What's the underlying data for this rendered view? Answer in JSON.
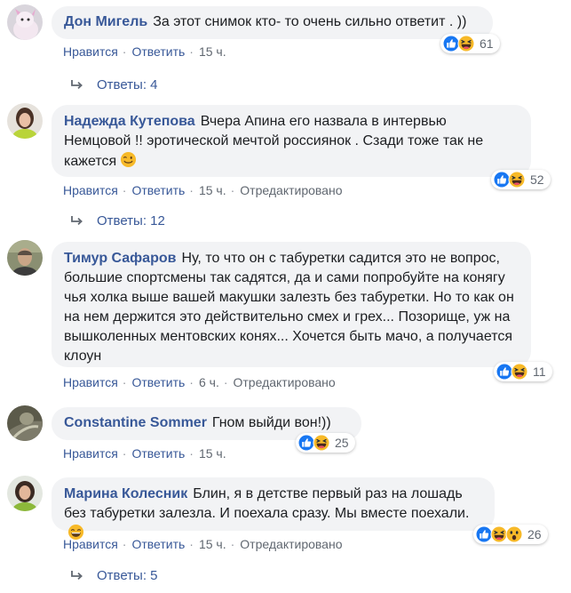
{
  "comments": [
    {
      "author": "Дон Мигель",
      "text": "За этот снимок кто- то очень сильно ответит . ))",
      "reaction_count": "61",
      "like_label": "Нравится",
      "reply_label": "Ответить",
      "time": "15 ч.",
      "replies": "Ответы: 4"
    },
    {
      "author": "Надежда Кутепова",
      "text": "Вчера Апина его назвала в интервью Немцовой !! эротической мечтой россиянок . Сзади тоже так не кажется",
      "reaction_count": "52",
      "like_label": "Нравится",
      "reply_label": "Ответить",
      "time": "15 ч.",
      "edited": "Отредактировано",
      "replies": "Ответы: 12"
    },
    {
      "author": "Тимур Сафаров",
      "text": "Ну, то что он с табуретки садится это не вопрос, большие спортсмены так садятся, да и сами попробуйте на конягу чья холка выше вашей макушки залезть без табуретки. Но то как он на нем держится это действительно смех и грех... Позорище, уж на вышколенных ментовских конях... Хочется быть мачо, а получается клоун",
      "reaction_count": "11",
      "like_label": "Нравится",
      "reply_label": "Ответить",
      "time": "6 ч.",
      "edited": "Отредактировано"
    },
    {
      "author": "Constantine Sommer",
      "text": "Гном выйди вон!))",
      "reaction_count": "25",
      "like_label": "Нравится",
      "reply_label": "Ответить",
      "time": "15 ч."
    },
    {
      "author": "Марина Колесник",
      "text": "Блин, я в детстве первый раз на лошадь без табуретки залезла. И поехала сразу. Мы вместе поехали.",
      "reaction_count": "26",
      "like_label": "Нравится",
      "reply_label": "Ответить",
      "time": "15 ч.",
      "edited": "Отредактировано",
      "replies": "Ответы: 5"
    }
  ],
  "colors": {
    "link": "#385898",
    "bubble": "#f2f3f5",
    "like_blue": "#1877f2",
    "haha_yellow": "#f7b928"
  },
  "icons": [
    "like-reaction-icon",
    "haha-reaction-icon",
    "wow-reaction-icon",
    "wink-emoji-icon",
    "laugh-emoji-icon",
    "reply-arrow-icon"
  ]
}
